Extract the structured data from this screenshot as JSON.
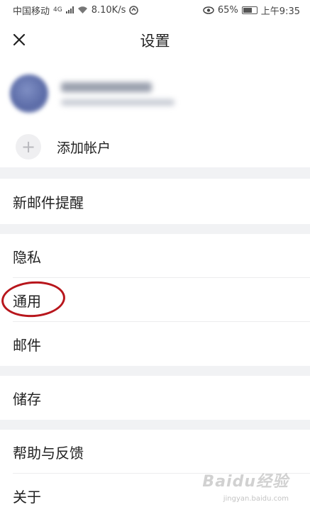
{
  "status_bar": {
    "carrier": "中国移动",
    "network": "4G",
    "speed": "8.10K/s",
    "battery": "65%",
    "time": "上午9:35"
  },
  "header": {
    "title": "设置",
    "close_icon": "close-icon"
  },
  "account": {
    "add_label": "添加帐户"
  },
  "menu": {
    "new_mail_alert": "新邮件提醒",
    "privacy": "隐私",
    "general": "通用",
    "mail": "邮件",
    "storage": "储存",
    "help_feedback": "帮助与反馈",
    "about": "关于"
  },
  "annotation": {
    "circle_color": "#b8161c"
  },
  "watermark": {
    "brand": "Baidu经验",
    "url": "jingyan.baidu.com"
  }
}
